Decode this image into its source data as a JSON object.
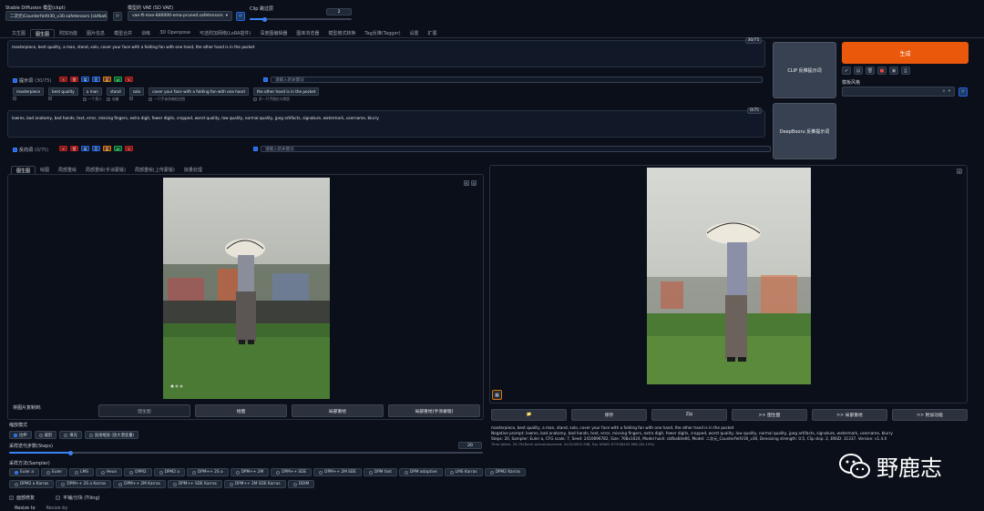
{
  "header": {
    "model_label": "Stable Diffusion 模型(ckpt)",
    "model_value": "二次元\\CounterfeitV30_v30.safetensors [cbfba6",
    "vae_label": "模型的 VAE (SD VAE)",
    "vae_value": "vae-ft-mse-840000-ema-pruned.safetensors",
    "clip_label": "Clip 跳过层",
    "clip_value": "2",
    "clip_fraction": 0.15
  },
  "main_tabs": [
    "文生图",
    "图生图",
    "附加功能",
    "图片信息",
    "模型合并",
    "训练",
    "3D Openpose",
    "可选附加网络(LoRA插件)",
    "深度图编辑器",
    "图库浏览器",
    "模型格式转换",
    "Tag反推(Tagger)",
    "设置",
    "扩展"
  ],
  "main_tab_active": 1,
  "prompt": {
    "counter": "30/75",
    "text": "masterpiece, best quality, a man, stand, solo, cover your face with a folding fan with one hand, the other hand is in the pocket",
    "label": "提示词",
    "count": "(30/75)",
    "search_placeholder": "请输入新关键词",
    "tags": [
      {
        "en": "masterpiece",
        "zh": ""
      },
      {
        "en": "best quality",
        "zh": ""
      },
      {
        "en": "a man",
        "zh": "一个男人"
      },
      {
        "en": "stand",
        "zh": "站着"
      },
      {
        "en": "solo",
        "zh": ""
      },
      {
        "en": "cover your face with a folding fan with one hand",
        "zh": "一只手拿折扇挡住脸"
      },
      {
        "en": "the other hand is in the pocket",
        "zh": "另一只手插在口袋里"
      }
    ]
  },
  "negative": {
    "counter": "0/75",
    "text": "lowres, bad anatomy, bad hands, text, error, missing fingers, extra digit, fewer digits, cropped, worst quality, low quality, normal quality, jpeg artifacts, signature, watermark, username, blurry",
    "label": "反向词",
    "count": "(0/75)",
    "search_placeholder": "请输入新关键词"
  },
  "side_buttons": {
    "clip": "CLIP 反推提示词",
    "deepbooru": "DeepBooru 反推提示词",
    "generate": "生成",
    "style_label": "模板风格"
  },
  "img_tabs": [
    "图生图",
    "绘图",
    "局部重绘",
    "局部重绘(手涂蒙版)",
    "局部重绘(上传蒙版)",
    "批量处理"
  ],
  "img_tab_active": 0,
  "copy_row": {
    "label": "将图片复制到:",
    "buttons": [
      "图生图",
      "绘图",
      "局部重绘",
      "局部重绘(手涂蒙版)"
    ]
  },
  "resize": {
    "label": "缩放模式",
    "options": [
      "拉伸",
      "裁剪",
      "填充",
      "直接缩放 (放大潜变量)"
    ],
    "selected": 0
  },
  "steps": {
    "label": "采样迭代步数(Steps)",
    "value": "20",
    "fraction": 0.13
  },
  "sampler": {
    "label": "采样方法(Sampler)",
    "row1": [
      "Euler a",
      "Euler",
      "LMS",
      "Heun",
      "DPM2",
      "DPM2 a",
      "DPM++ 2S a",
      "DPM++ 2M",
      "DPM++ SDE",
      "DPM++ 2M SDE",
      "DPM fast",
      "DPM adaptive",
      "LMS Karras",
      "DPM2 Karras"
    ],
    "row2": [
      "DPM2 a Karras",
      "DPM++ 2S a Karras",
      "DPM++ 2M Karras",
      "DPM++ SDE Karras",
      "DPM++ 2M SDE Karras",
      "DDIM"
    ],
    "selected": 0
  },
  "options": {
    "face": "面部修复",
    "tiling": "平铺/分块 (Tiling)"
  },
  "bottom": {
    "resize_to": "Resize to",
    "resize_by": "Resize by"
  },
  "output": {
    "buttons": [
      "📁",
      "保存",
      "Zip",
      ">> 图生图",
      ">> 局部重绘",
      ">> 附加功能"
    ],
    "info_prompt": "masterpiece, best quality, a man, stand, solo, cover your face with a folding fan with one hand, the other hand is in the pocket",
    "info_negative": "Negative prompt: lowres, bad anatomy, bad hands, text, error, missing fingers, extra digit, fewer digits, cropped, worst quality, low quality, normal quality, jpeg artifacts, signature, watermark, username, blurry",
    "info_params": "Steps: 20, Sampler: Euler a, CFG scale: 7, Seed: 2410696782, Size: 768x1024, Model hash: cbfba64e66, Model: 二次元_CounterfeitV30_v30, Denoising strength: 0.5, Clip skip: 2, ENSD: 31337, Version: v1.4.0",
    "info_time": "Time taken: 29.75sTorch active/reserved: 4122/4922 MiB, Sys VRAM: 6733/8192 MiB (82.19%)"
  },
  "watermark": {
    "text": "野鹿志"
  },
  "colors": {
    "background": "#0b0f19",
    "generate": "#ea580c",
    "accent": "#3b82f6"
  }
}
